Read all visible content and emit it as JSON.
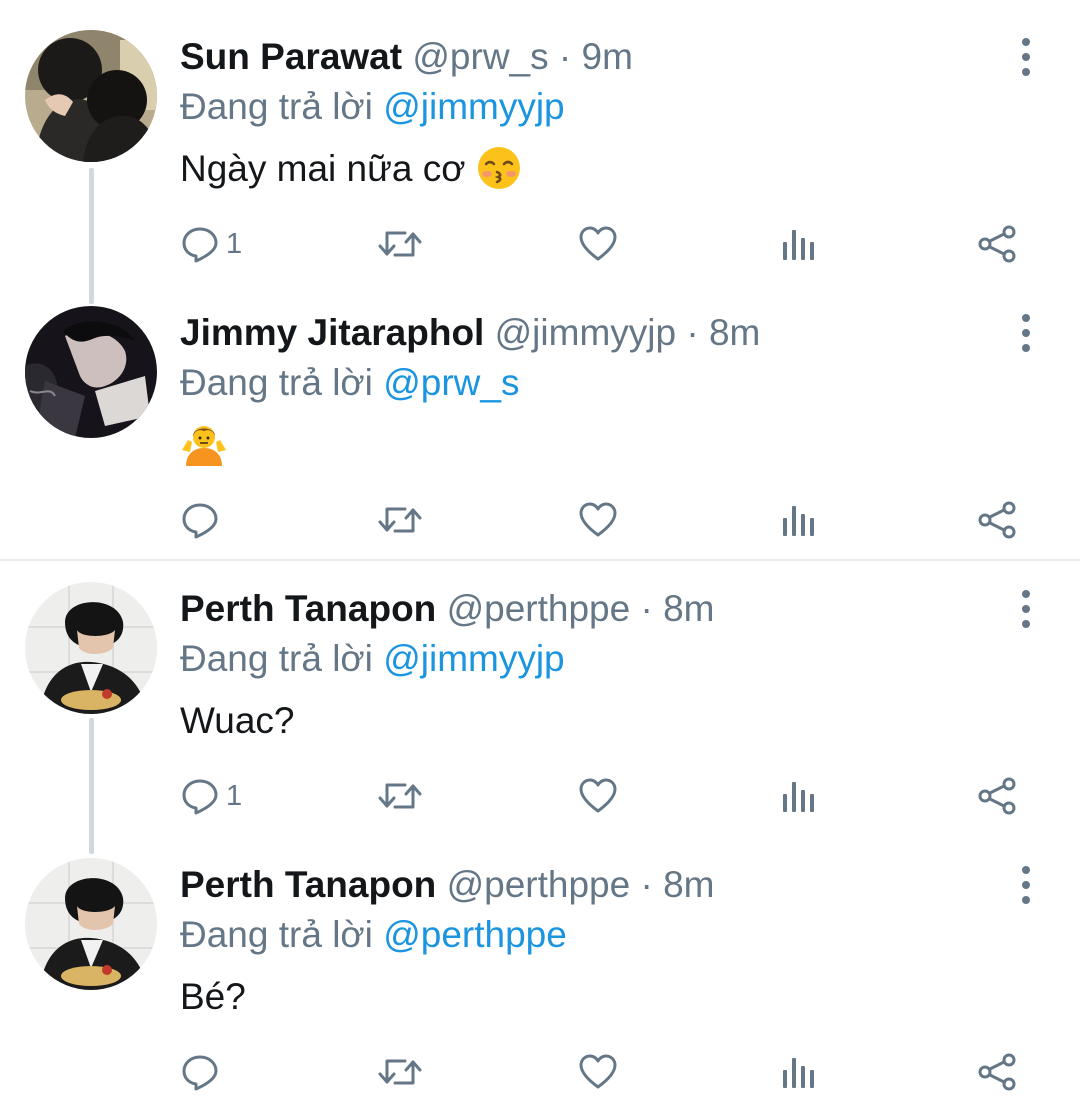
{
  "colors": {
    "text": "#14171a",
    "secondary": "#657786",
    "mention": "#1b95e0",
    "divider": "#e6ecf0",
    "thread_line": "#d2d8dc"
  },
  "reply_prefix": "Đang trả lời",
  "tweets": [
    {
      "name": "Sun Parawat",
      "handle": "@prw_s",
      "separator": "·",
      "time": "9m",
      "reply_to": "@jimmyyjp",
      "text": "Ngày mai nữa cơ",
      "emoji": "kissing-face-emoji",
      "reply_count": "1"
    },
    {
      "name": "Jimmy Jitaraphol",
      "handle": "@jimmyyjp",
      "separator": "·",
      "time": "8m",
      "reply_to": "@prw_s",
      "text": "",
      "emoji": "person-shrugging-emoji",
      "reply_count": ""
    },
    {
      "name": "Perth Tanapon",
      "handle": "@perthppe",
      "separator": "·",
      "time": "8m",
      "reply_to": "@jimmyyjp",
      "text": "Wuac?",
      "emoji": "",
      "reply_count": "1"
    },
    {
      "name": "Perth Tanapon",
      "handle": "@perthppe",
      "separator": "·",
      "time": "8m",
      "reply_to": "@perthppe",
      "text": "Bé?",
      "emoji": "",
      "reply_count": ""
    }
  ]
}
